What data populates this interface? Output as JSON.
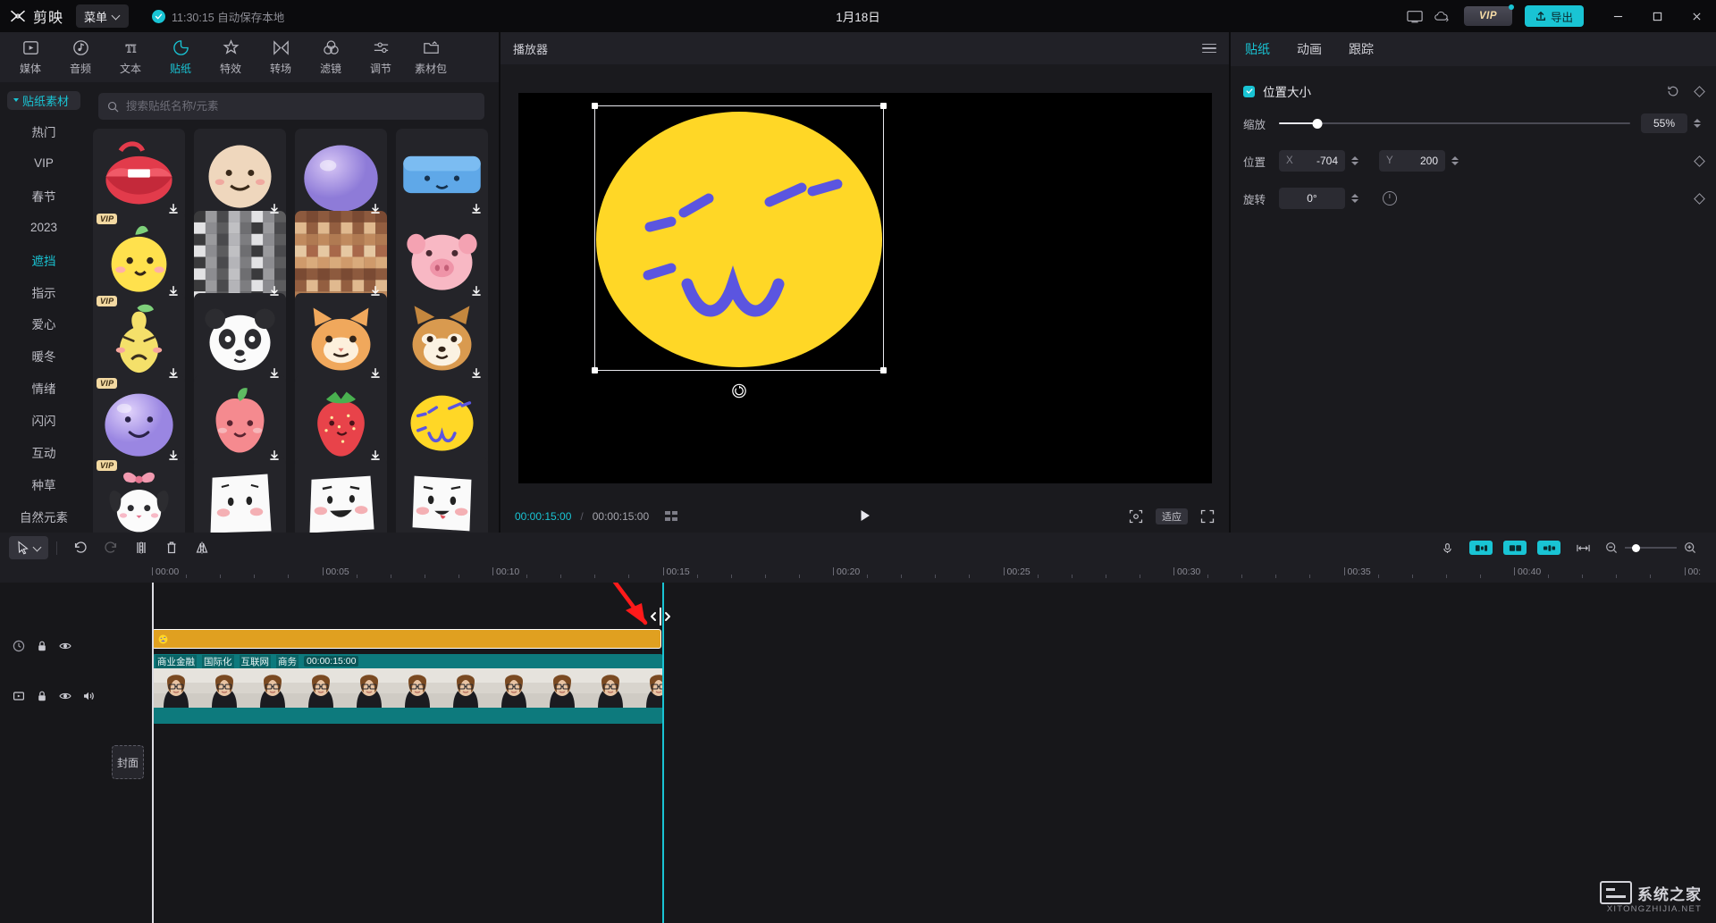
{
  "titlebar": {
    "app_name": "剪映",
    "menu_label": "菜单",
    "autosave_text": "11:30:15 自动保存本地",
    "project_title": "1月18日",
    "vip_label": "VIP",
    "export_label": "导出",
    "icons": {
      "logo": "capcut-logo-icon",
      "chevron": "chevron-down-icon",
      "check": "check-circle-icon",
      "monitor": "monitor-icon",
      "cloud": "cloud-icon",
      "minimize": "minimize-icon",
      "maximize": "maximize-icon",
      "close": "close-icon"
    }
  },
  "toolbar_tabs": [
    {
      "label": "媒体",
      "icon": "media-icon",
      "active": false
    },
    {
      "label": "音频",
      "icon": "audio-icon",
      "active": false
    },
    {
      "label": "文本",
      "icon": "text-icon",
      "active": false
    },
    {
      "label": "贴纸",
      "icon": "sticker-icon",
      "active": true
    },
    {
      "label": "特效",
      "icon": "effects-icon",
      "active": false
    },
    {
      "label": "转场",
      "icon": "transition-icon",
      "active": false
    },
    {
      "label": "滤镜",
      "icon": "filter-icon",
      "active": false
    },
    {
      "label": "调节",
      "icon": "adjust-icon",
      "active": false
    },
    {
      "label": "素材包",
      "icon": "material-pack-icon",
      "active": false
    }
  ],
  "library": {
    "category_header": "贴纸素材",
    "categories": [
      {
        "label": "热门",
        "active": false
      },
      {
        "label": "VIP",
        "active": false
      },
      {
        "label": "春节",
        "active": false
      },
      {
        "label": "2023",
        "active": false
      },
      {
        "label": "遮挡",
        "active": true
      },
      {
        "label": "指示",
        "active": false
      },
      {
        "label": "爱心",
        "active": false
      },
      {
        "label": "暖冬",
        "active": false
      },
      {
        "label": "情绪",
        "active": false
      },
      {
        "label": "闪闪",
        "active": false
      },
      {
        "label": "互动",
        "active": false
      },
      {
        "label": "种草",
        "active": false
      },
      {
        "label": "自然元素",
        "active": false
      }
    ],
    "search_placeholder": "搜索贴纸名称/元素",
    "search_value": "",
    "vip_badge": "VIP",
    "download_icon": "download-icon",
    "items": [
      {
        "name": "sticker-lips",
        "vip": false,
        "download": true,
        "art": "lips"
      },
      {
        "name": "sticker-beige-face",
        "vip": false,
        "download": true,
        "art": "beige"
      },
      {
        "name": "sticker-purple-ball",
        "vip": false,
        "download": true,
        "art": "purpleball"
      },
      {
        "name": "sticker-blue-strip",
        "vip": false,
        "download": true,
        "art": "bluestrip"
      },
      {
        "name": "sticker-yellow-bird",
        "vip": true,
        "download": true,
        "art": "yellowbird"
      },
      {
        "name": "sticker-mosaic-gray",
        "vip": false,
        "download": true,
        "art": "mosaicgray"
      },
      {
        "name": "sticker-mosaic-warm",
        "vip": false,
        "download": true,
        "art": "mosaicwarm"
      },
      {
        "name": "sticker-pig-face",
        "vip": false,
        "download": true,
        "art": "pig"
      },
      {
        "name": "sticker-sad-pear",
        "vip": true,
        "download": true,
        "art": "sadpear"
      },
      {
        "name": "sticker-panda",
        "vip": false,
        "download": true,
        "art": "panda"
      },
      {
        "name": "sticker-orange-cat",
        "vip": false,
        "download": true,
        "art": "orangecat"
      },
      {
        "name": "sticker-shiba-dog",
        "vip": false,
        "download": true,
        "art": "shiba"
      },
      {
        "name": "sticker-purple-smile",
        "vip": true,
        "download": true,
        "art": "purplesmile"
      },
      {
        "name": "sticker-peach",
        "vip": false,
        "download": true,
        "art": "peach"
      },
      {
        "name": "sticker-strawberry",
        "vip": false,
        "download": true,
        "art": "strawberry"
      },
      {
        "name": "sticker-yellow-cute",
        "vip": false,
        "download": false,
        "art": "yellowcute"
      },
      {
        "name": "sticker-bunny-bow",
        "vip": true,
        "download": true,
        "art": "bunnybow"
      },
      {
        "name": "sticker-tissue-shy",
        "vip": false,
        "download": true,
        "art": "tissue1"
      },
      {
        "name": "sticker-tissue-laugh",
        "vip": false,
        "download": true,
        "art": "tissue2"
      },
      {
        "name": "sticker-tissue-tongue",
        "vip": false,
        "download": true,
        "art": "tissue3"
      }
    ]
  },
  "player": {
    "title": "播放器",
    "current_time": "00:00:15:00",
    "total_time": "00:00:15:00",
    "ratio_label": "适应",
    "menu_icon": "hamburger-icon",
    "play_icon": "play-icon",
    "grid_icon": "grid-icon",
    "crop_icon": "crop-icon",
    "fullscreen_icon": "fullscreen-icon",
    "rotate_icon": "rotate-icon"
  },
  "properties": {
    "tabs": [
      {
        "label": "贴纸",
        "active": true
      },
      {
        "label": "动画",
        "active": false
      },
      {
        "label": "跟踪",
        "active": false
      }
    ],
    "section": {
      "title": "位置大小",
      "checked": true,
      "reset_icon": "reset-icon",
      "keyframe_icon": "keyframe-diamond-icon"
    },
    "scale": {
      "label": "缩放",
      "value": "55%",
      "percent": 11
    },
    "position": {
      "label": "位置",
      "x_key": "X",
      "x_value": "-704",
      "y_key": "Y",
      "y_value": "200"
    },
    "rotation": {
      "label": "旋转",
      "value": "0°"
    }
  },
  "timeline": {
    "tools": [
      {
        "name": "select-tool",
        "icon": "cursor-icon",
        "active": true
      },
      {
        "name": "undo-tool",
        "icon": "undo-icon",
        "active": false
      },
      {
        "name": "redo-tool",
        "icon": "redo-icon",
        "active": false,
        "disabled": true
      },
      {
        "name": "split-tool",
        "icon": "split-icon",
        "active": false
      },
      {
        "name": "delete-tool",
        "icon": "trash-icon",
        "active": false
      },
      {
        "name": "mirror-tool",
        "icon": "mirror-icon",
        "active": false
      }
    ],
    "right_tools": [
      {
        "name": "record-tool",
        "icon": "microphone-icon",
        "on": false
      },
      {
        "name": "track-view-a",
        "icon": "track-a-icon",
        "on": true
      },
      {
        "name": "track-view-b",
        "icon": "track-b-icon",
        "on": true
      },
      {
        "name": "track-view-c",
        "icon": "track-c-icon",
        "on": true
      },
      {
        "name": "adapt-tool",
        "icon": "adapt-icon",
        "on": false
      }
    ],
    "zoom_out_icon": "zoom-out-icon",
    "zoom_in_icon": "zoom-in-icon",
    "ruler_labels": [
      "00:00",
      "00:05",
      "00:10",
      "00:15",
      "00:20",
      "00:25",
      "00:30",
      "00:35",
      "00:40",
      "00:"
    ],
    "cover_label": "封面",
    "sticker_clip": {
      "name": "sticker-clip"
    },
    "video_clip": {
      "tags": [
        "商业金融",
        "国际化",
        "互联网",
        "商务"
      ],
      "duration": "00:00:15:00"
    }
  },
  "watermark": {
    "title": "系统之家",
    "sub": "XITONGZHIJIA.NET"
  },
  "colors": {
    "accent": "#19c4d4",
    "sticker_clip": "#e0a020",
    "video_clip": "#0d7a7d",
    "annotation_arrow": "#ff1a1a",
    "panel_bg": "#1a1a1e",
    "titlebar_bg": "#0b0b0d"
  }
}
